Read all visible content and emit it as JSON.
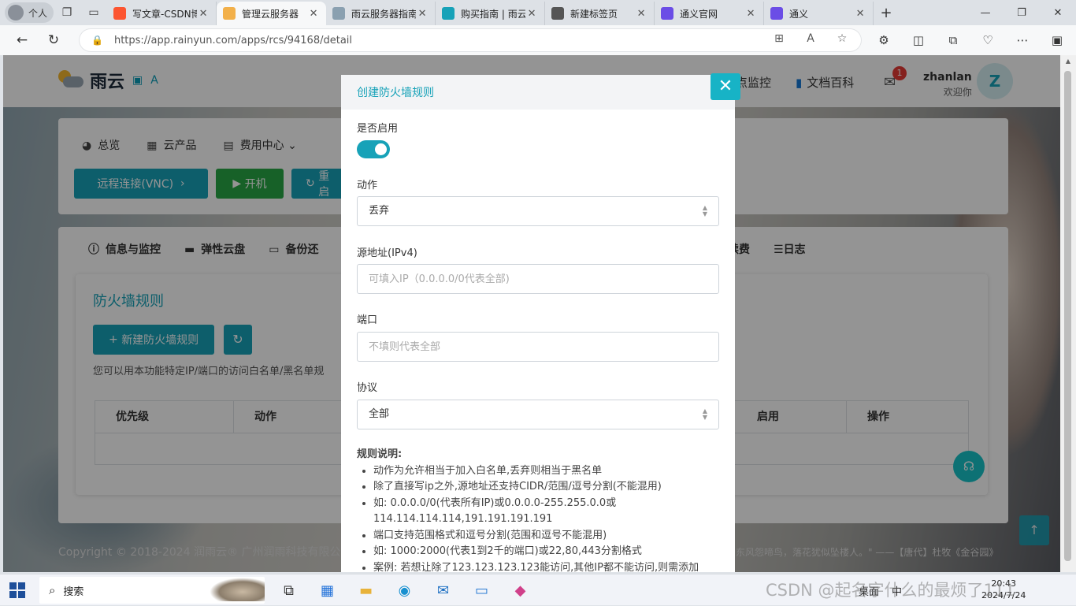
{
  "browser": {
    "profile_label": "个人",
    "tabs": [
      {
        "title": "写文章-CSDN博客",
        "favicon_color": "#fc5531",
        "active": false
      },
      {
        "title": "管理云服务器",
        "favicon_color": "#f2b04a",
        "active": true
      },
      {
        "title": "雨云服务器指南",
        "favicon_color": "#8aa0b0",
        "active": false
      },
      {
        "title": "购买指南 | 雨云",
        "favicon_color": "#17a2b8",
        "active": false
      },
      {
        "title": "新建标签页",
        "favicon_color": "#555555",
        "active": false
      },
      {
        "title": "通义官网",
        "favicon_color": "#6b4de6",
        "active": false
      },
      {
        "title": "通义",
        "favicon_color": "#6b4de6",
        "active": false
      }
    ],
    "url": "https://app.rainyun.com/apps/rcs/94168/detail"
  },
  "site": {
    "logo_text": "雨云",
    "header_links": [
      "点监控",
      "文档百科"
    ],
    "notification_count": "1",
    "username": "zhanlan",
    "welcome": "欢迎你",
    "avatar_letter": "Z",
    "subnav": [
      "总览",
      "云产品",
      "费用中心"
    ],
    "actions": [
      "远程连接(VNC)",
      "开机",
      "重启"
    ],
    "detail_tabs_left": [
      "信息与监控",
      "弹性云盘",
      "备份还"
    ],
    "detail_tabs_right": [
      "续费",
      "日志"
    ],
    "firewall": {
      "title": "防火墙规则",
      "new_button": "新建防火墙规则",
      "description": "您可以用本功能特定IP/端口的访问白名单/黑名单规",
      "columns": [
        "优先级",
        "动作",
        "启用",
        "操作"
      ]
    },
    "footer": "Copyright © 2018-2024 润雨云® 广州润雨科技有限公",
    "quote": "东风怨啼鸟，落花犹似坠楼人。\" ——【唐代】杜牧《金谷园》"
  },
  "modal": {
    "title": "创建防火墙规则",
    "enable_label": "是否启用",
    "enabled": true,
    "action_label": "动作",
    "action_value": "丢弃",
    "source_label": "源地址(IPv4)",
    "source_placeholder": "可填入IP（0.0.0.0/0代表全部)",
    "port_label": "端口",
    "port_placeholder": "不填则代表全部",
    "protocol_label": "协议",
    "protocol_value": "全部",
    "rules_title": "规则说明:",
    "rules": [
      "动作为允许相当于加入白名单,丢弃则相当于黑名单",
      "除了直接写ip之外,源地址还支持CIDR/范围/逗号分割(不能混用)",
      "如: 0.0.0.0/0(代表所有IP)或0.0.0.0-255.255.0.0或114.114.114.114,191.191.191.191",
      "端口支持范围格式和逗号分割(范围和逗号不能混用)",
      "如: 1000:2000(代表1到2千的端口)或22,80,443分割格式",
      "案例: 若想让除了123.123.123.123能访问,其他IP都不能访问,则需添加"
    ]
  },
  "taskbar": {
    "search_label": "搜索",
    "tray_items": [
      "桌面",
      "中"
    ],
    "time": "20:43",
    "date": "2024/7/24"
  },
  "watermark": "CSDN @起名字什么的最烦了111",
  "colors": {
    "accent": "#17a2b8",
    "green": "#28a745",
    "badge": "#e53935"
  }
}
